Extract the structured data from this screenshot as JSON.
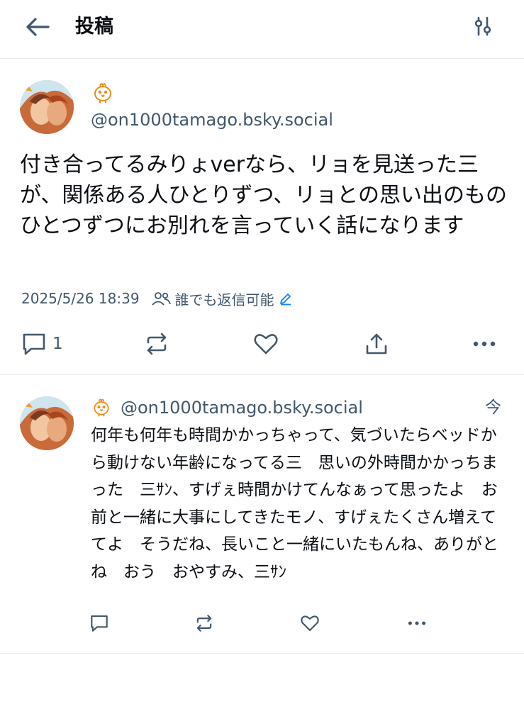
{
  "header": {
    "title": "投稿"
  },
  "post": {
    "handle": "@on1000tamago.bsky.social",
    "text": "付き合ってるみりょverなら、リョを見送った三が、関係ある人ひとりずつ、リョとの思い出のものひとつずつにお別れを言っていく話になります",
    "timestamp": "2025/5/26 18:39",
    "reply_setting": "誰でも返信可能",
    "reply_count": "1"
  },
  "reply": {
    "handle": "@on1000tamago.bsky.social",
    "time": "今",
    "text": "何年も何年も時間かかっちゃって、気づいたらベッドから動けない年齢になってる三　思いの外時間かかっちまった　三ｻﾝ、すげぇ時間かけてんなぁって思ったよ　お前と一緒に大事にしてきたモノ、すげぇたくさん増えててよ　そうだね、長いこと一緒にいたもんね、ありがとね　おう　おやすみ、三ｻﾝ"
  },
  "icons": {
    "back": "arrow-left-icon",
    "filter": "sliders-icon",
    "reply": "speech-bubble-icon",
    "repost": "repost-icon",
    "like": "heart-icon",
    "share": "share-icon",
    "more": "ellipsis-icon",
    "emoji": "chick-icon"
  },
  "colors": {
    "text": "#0b0f14",
    "muted": "#42576c",
    "accent": "#1083fe",
    "divider": "#e6e9ee"
  }
}
